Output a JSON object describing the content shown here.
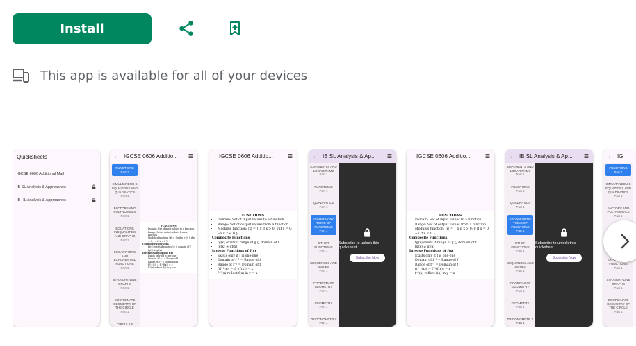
{
  "actions": {
    "install_label": "Install",
    "share_icon": "share-icon",
    "wishlist_icon": "bookmark-add-icon"
  },
  "devices": {
    "icon": "devices-icon",
    "text": "This app is available for all of your devices"
  },
  "screenshots": {
    "s1": {
      "title": "Quicksheets",
      "items": [
        "IGCSE 0606 Additional Math",
        "IB SL Analysis & Approaches",
        "IB HL Analysis & Approaches"
      ]
    },
    "s2": {
      "title": "IGCSE 0606 Additio...",
      "side": [
        {
          "label": "FUNCTIONS",
          "sub": "Part 1"
        },
        {
          "label": "SIMULTANEOU S EQUATIONS AND QUADRATICS",
          "sub": "Part 1"
        },
        {
          "label": "FACTORS AND POLYNOMIALS",
          "sub": "Part 1"
        },
        {
          "label": "EQUATIONS INEQUALITIES AND GRAPHS",
          "sub": "Part 1"
        },
        {
          "label": "LOGARITHMIC AND EXPONENTIAL FUNCTIONS",
          "sub": "Part 1"
        },
        {
          "label": "STRAIGHT-LINE GRAPHS",
          "sub": "Part 1"
        },
        {
          "label": "COORDINATE GEOMETRY OF THE CIRCLE",
          "sub": "Part 1"
        },
        {
          "label": "CIRCULAR",
          "sub": ""
        }
      ]
    },
    "s3": {
      "title": "IGCSE 0606 Additio...",
      "doc": {
        "heading": "FUNCTIONS",
        "b1": "Domain: Set of input values to a function",
        "b2": "Range: Set of output values from a function",
        "b3": "Modulus function: |x| = { x if x > 0; 0 if x = 0; −x if x < 0 }",
        "h2": "Composite Functions",
        "b4": "fg(x) exists if range of g ⊆ domain of f",
        "b5": "fg(x) ≠ gf(x)",
        "h3": "Inverse Functions of f(x)",
        "b6": "Exists only if f is one-one",
        "b7": "Domain of f⁻¹ = Range of f",
        "b8": "Range of f⁻¹ = Domain of f",
        "b9": "f(f⁻¹(x)) = f⁻¹(f(x)) = x",
        "b10": "f⁻¹(x) reflect f(x) in y = x"
      }
    },
    "s4": {
      "title": "IB SL Analysis & Ap...",
      "side": [
        {
          "label": "EXPONENTS AND LOGARITHMS",
          "sub": "Part 1"
        },
        {
          "label": "FUNCTIONS",
          "sub": "Part 1"
        },
        {
          "label": "QUADRATICS",
          "sub": "Part 1"
        },
        {
          "label": "TRANSFORMA TIONS OF FUNCTIONS",
          "sub": "Part 1"
        },
        {
          "label": "OTHER FUNCTIONS",
          "sub": "Part 1"
        },
        {
          "label": "SEQUENCES AND SERIES",
          "sub": "Part 1"
        },
        {
          "label": "COORDINATE GEOMETRY",
          "sub": "Part 1"
        },
        {
          "label": "GEOMETRY",
          "sub": "Part 1"
        },
        {
          "label": "TRIGONOMETR Y Part 1",
          "sub": ""
        }
      ],
      "lock_icon": "lock-icon",
      "message": "Subscribe to unlock this quicksheet",
      "button": "Subscribe Now"
    },
    "s5": {
      "title": "IGCSE 0606 Additio..."
    },
    "s6": {
      "title": "IB SL Analysis & Ap..."
    },
    "s7": {
      "title": "IG",
      "active": "FUNCTIONS"
    }
  },
  "carousel": {
    "next_icon": "chevron-right-icon"
  }
}
